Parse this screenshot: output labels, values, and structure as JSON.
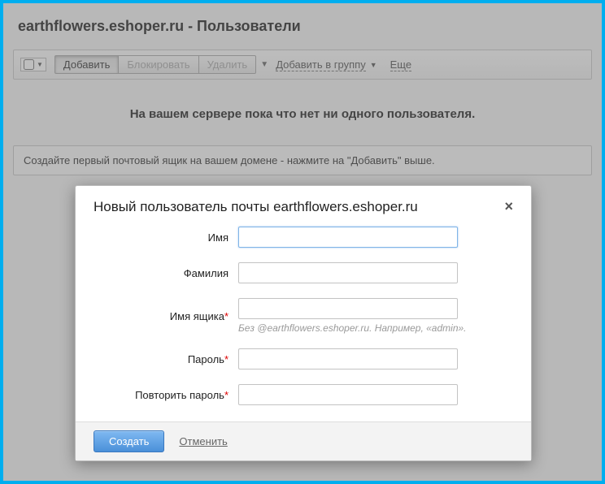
{
  "page": {
    "title": "earthflowers.eshoper.ru - Пользователи"
  },
  "toolbar": {
    "add": "Добавить",
    "block": "Блокировать",
    "delete": "Удалить",
    "add_to_group": "Добавить в группу",
    "more": "Еще"
  },
  "messages": {
    "empty": "На вашем сервере пока что нет ни одного пользователя.",
    "hint": "Создайте первый почтовый ящик на вашем домене - нажмите на \"Добавить\" выше."
  },
  "modal": {
    "title": "Новый пользователь почты earthflowers.eshoper.ru",
    "labels": {
      "first_name": "Имя",
      "last_name": "Фамилия",
      "login": "Имя ящика",
      "password": "Пароль",
      "password_confirm": "Повторить пароль",
      "required_mark": "*"
    },
    "hints": {
      "login": "Без @earthflowers.eshoper.ru. Например, «admin»."
    },
    "buttons": {
      "create": "Создать",
      "cancel": "Отменить"
    },
    "close": "×"
  }
}
